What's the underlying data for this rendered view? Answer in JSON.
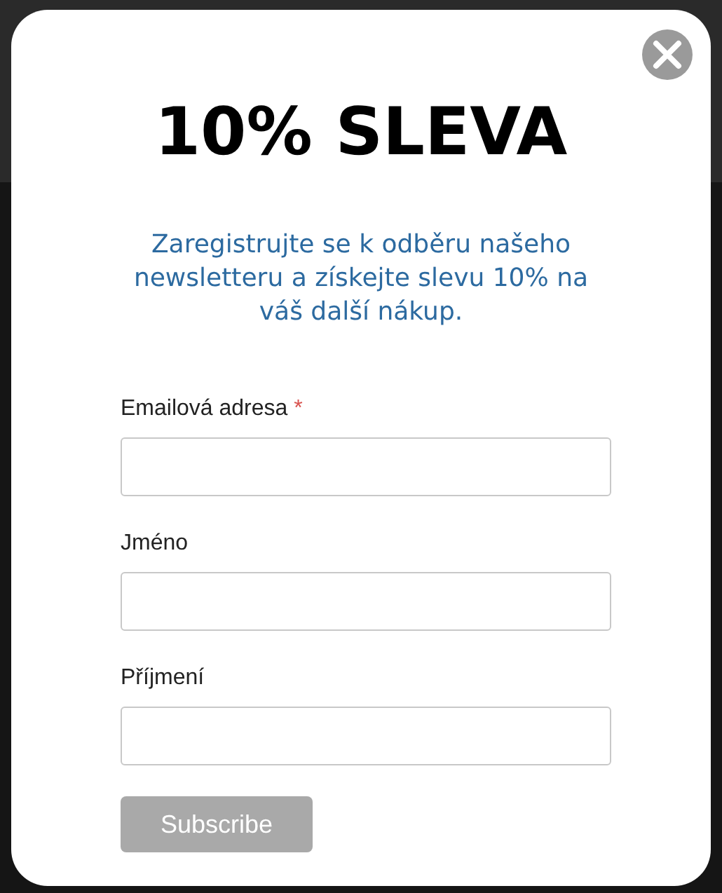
{
  "popup": {
    "title": "10% SLEVA",
    "intro": "Zaregistrujte se k odběru našeho newsletteru a získejte slevu 10% na váš další nákup.",
    "fields": [
      {
        "label": "Emailová adresa",
        "required": true
      },
      {
        "label": "Jméno",
        "required": false
      },
      {
        "label": "Příjmení",
        "required": false
      }
    ],
    "required_mark": "*",
    "button": "Subscribe"
  }
}
